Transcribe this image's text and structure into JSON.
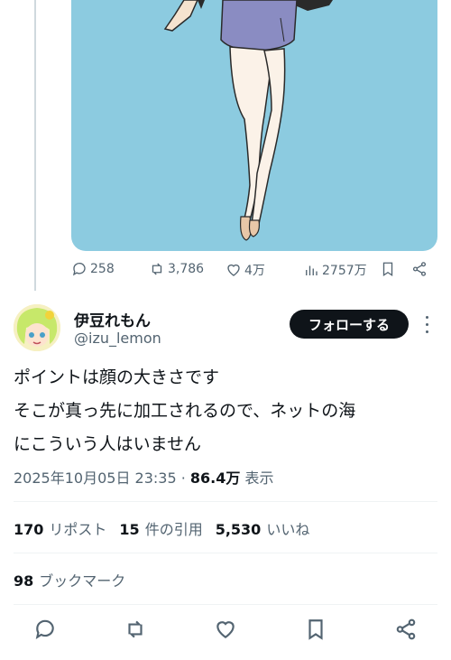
{
  "previous_tweet": {
    "actions": {
      "replies": "258",
      "reposts": "3,786",
      "likes": "4万",
      "views": "2757万"
    }
  },
  "tweet": {
    "author": {
      "display_name": "伊豆れもん",
      "handle": "@izu_lemon"
    },
    "follow_label": "フォローする",
    "text_lines": [
      "ポイントは顔の大きさです",
      "そこが真っ先に加工されるので、ネットの海",
      "にこういう人はいません"
    ],
    "timestamp": "2025年10月05日 23:35",
    "separator": " · ",
    "view_count": "86.4万",
    "view_label": " 表示",
    "stats": {
      "reposts_count": "170",
      "reposts_label": "リポスト",
      "quotes_count": "15",
      "quotes_label": "件の引用",
      "likes_count": "5,530",
      "likes_label": "いいね",
      "bookmarks_count": "98",
      "bookmarks_label": "ブックマーク"
    }
  },
  "colors": {
    "accent_text": "#0f1419",
    "muted": "#536471",
    "media_bg": "#8ccbe0"
  }
}
